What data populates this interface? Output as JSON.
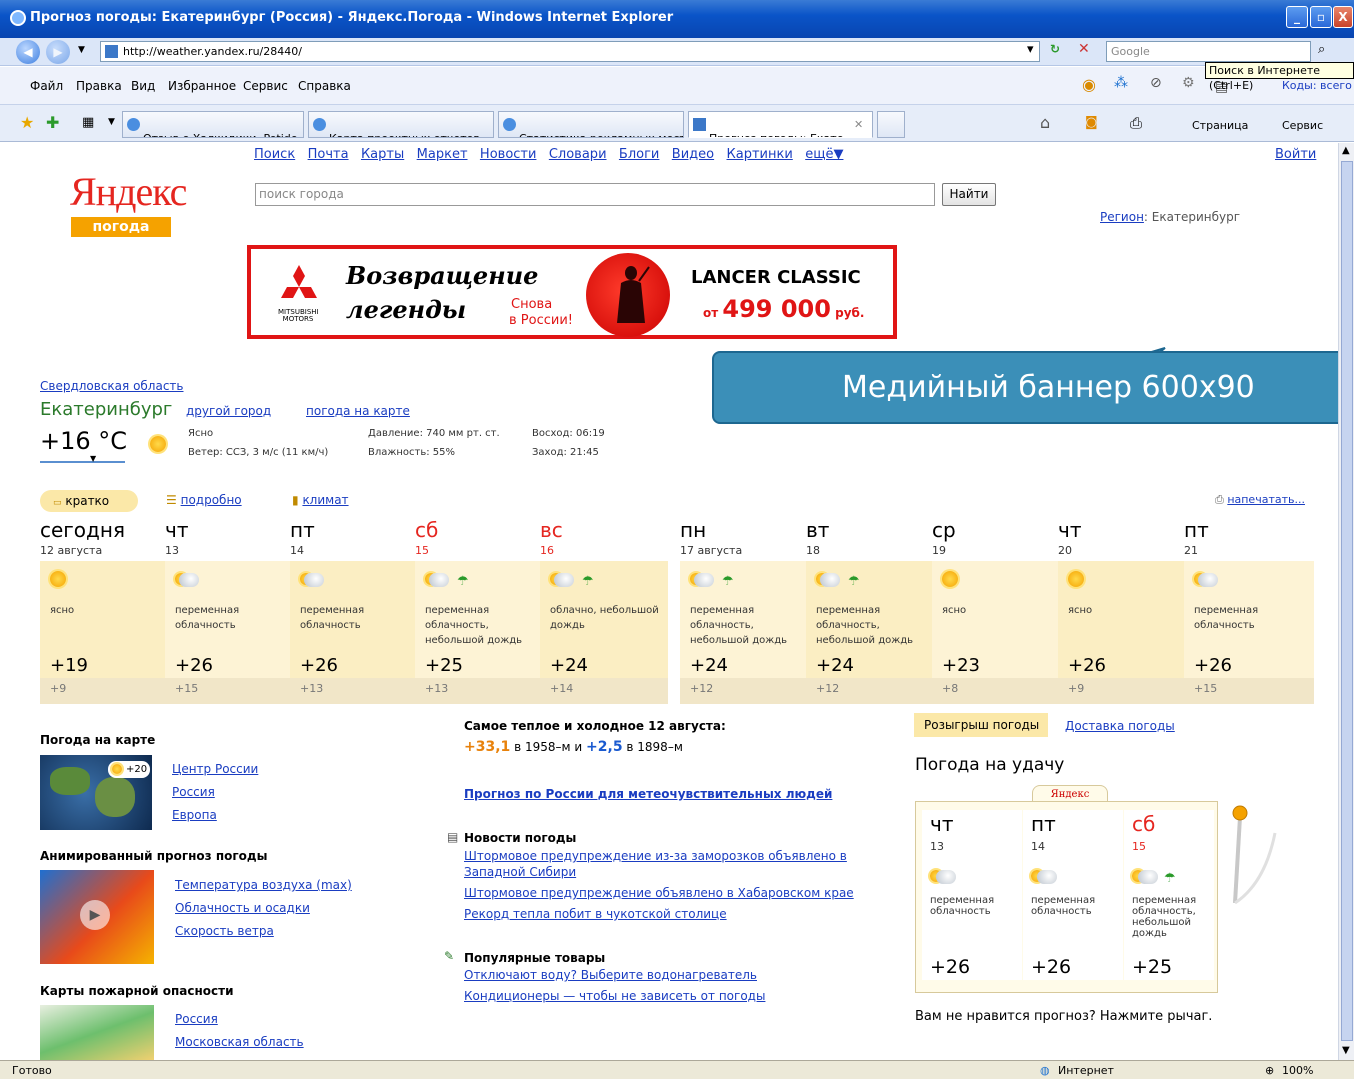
{
  "window": {
    "title": "Прогноз погоды: Екатеринбург (Россия) - Яндекс.Погода - Windows Internet Explorer",
    "buttons": [
      "_",
      "▫",
      "X"
    ]
  },
  "address_bar": {
    "url": "http://weather.yandex.ru/28440/",
    "search_placeholder": "Google"
  },
  "tooltip": "Поиск в Интернете (Ctrl+E)",
  "menu": [
    "Файл",
    "Правка",
    "Вид",
    "Избранное",
    "Сервис",
    "Справка"
  ],
  "codes_label": "Коды: всего н",
  "tabs": [
    {
      "label": "Отзыв о Халкидики, Potide..."
    },
    {
      "label": "Карта проектных отчетов ..."
    },
    {
      "label": "Статистика рекламных мест"
    },
    {
      "label": "Прогноз погоды: Екате..."
    }
  ],
  "right_tools": {
    "page": "Страница",
    "service": "Сервис"
  },
  "yandex": {
    "nav": [
      "Поиск",
      "Почта",
      "Карты",
      "Маркет",
      "Новости",
      "Словари",
      "Блоги",
      "Видео",
      "Картинки",
      "ещё▼"
    ],
    "login": "Войти",
    "logo": "Яндекс",
    "logo_sub": "погода",
    "search_placeholder": "поиск города",
    "find_button": "Найти",
    "region_label": "Регион",
    "region_value": ": Екатеринбург"
  },
  "banner": {
    "brand": "MITSUBISHI MOTORS",
    "line1": "Возвращение",
    "line2": "легенды",
    "again": "Снова",
    "in_russia": "в России!",
    "model": "LANCER CLASSIC",
    "price_prefix": "от",
    "price": "499 000",
    "currency": "руб."
  },
  "callout": "Медийный баннер 600х90",
  "current": {
    "region": "Свердловская область",
    "city": "Екатеринбург",
    "other_city": "другой город",
    "on_map": "погода на карте",
    "temp": "+16 °C",
    "cond": "Ясно",
    "wind": "Ветер: ССЗ, 3 м/с (11 км/ч)",
    "pressure": "Давление: 740 мм рт. ст.",
    "humidity": "Влажность: 55%",
    "sunrise": "Восход: 06:19",
    "sunset": "Заход: 21:45"
  },
  "modes": {
    "short": "кратко",
    "detail": "подробно",
    "climate": "климат",
    "print": "напечатать..."
  },
  "forecast": [
    {
      "day": "сегодня",
      "date": "12 августа",
      "icon": "sun",
      "cond": "ясно",
      "t_day": "+19",
      "t_night": "+9",
      "red": false
    },
    {
      "day": "чт",
      "date": "13",
      "icon": "cloud",
      "cond": "переменная облачность",
      "t_day": "+26",
      "t_night": "+15",
      "red": false
    },
    {
      "day": "пт",
      "date": "14",
      "icon": "cloud",
      "cond": "переменная облачность",
      "t_day": "+26",
      "t_night": "+13",
      "red": false
    },
    {
      "day": "сб",
      "date": "15",
      "icon": "cloud-rain",
      "cond": "переменная облачность, небольшой дождь",
      "t_day": "+25",
      "t_night": "+13",
      "red": true
    },
    {
      "day": "вс",
      "date": "16",
      "icon": "cloud-rain",
      "cond": "облачно, небольшой дождь",
      "t_day": "+24",
      "t_night": "+14",
      "red": true
    },
    {
      "day": "пн",
      "date": "17 августа",
      "icon": "cloud-rain",
      "cond": "переменная облачность, небольшой дождь",
      "t_day": "+24",
      "t_night": "+12",
      "red": false
    },
    {
      "day": "вт",
      "date": "18",
      "icon": "cloud-rain",
      "cond": "переменная облачность, небольшой дождь",
      "t_day": "+24",
      "t_night": "+12",
      "red": false
    },
    {
      "day": "ср",
      "date": "19",
      "icon": "sun",
      "cond": "ясно",
      "t_day": "+23",
      "t_night": "+8",
      "red": false
    },
    {
      "day": "чт",
      "date": "20",
      "icon": "sun",
      "cond": "ясно",
      "t_day": "+26",
      "t_night": "+9",
      "red": false
    },
    {
      "day": "пт",
      "date": "21",
      "icon": "cloud",
      "cond": "переменная облачность",
      "t_day": "+26",
      "t_night": "+15",
      "red": false
    }
  ],
  "left_col": {
    "map_title": "Погода на карте",
    "map_temp": "+20",
    "map_links": [
      "Центр России",
      "Россия",
      "Европа"
    ],
    "anim_title": "Анимированный прогноз погоды",
    "anim_links": [
      "Температура воздуха (max)",
      "Облачность и осадки",
      "Скорость ветра"
    ],
    "fire_title": "Карты пожарной опасности",
    "fire_links": [
      "Россия",
      "Московская область"
    ]
  },
  "middle_col": {
    "extreme_title": "Самое теплое и холодное 12 августа:",
    "warm": "+33,1",
    "warm_year": "в 1958–м и",
    "cold": "+2,5",
    "cold_year": "в 1898–м",
    "meteo_link": "Прогноз по России для метеочувствительных людей",
    "news_title": "Новости погоды",
    "news": [
      "Штормовое предупреждение из-за заморозков объявлено в Западной Сибири",
      "Штормовое предупреждение объявлено в Хабаровском крае",
      "Рекорд тепла побит в чукотской столице"
    ],
    "goods_title": "Популярные товары",
    "goods": [
      "Отключают воду? Выберите водонагреватель",
      "Кондиционеры — чтобы не зависеть от погоды"
    ]
  },
  "right_col": {
    "draw_tab": "Розыгрыш погоды",
    "delivery_tab": "Доставка погоды",
    "luck_title": "Погода на удачу",
    "slot_logo": "Яндекс",
    "slots": [
      {
        "day": "чт",
        "date": "13",
        "icon": "cloud",
        "cond": "переменная облачность",
        "temp": "+26",
        "red": false
      },
      {
        "day": "пт",
        "date": "14",
        "icon": "cloud",
        "cond": "переменная облачность",
        "temp": "+26",
        "red": false
      },
      {
        "day": "сб",
        "date": "15",
        "icon": "cloud-rain",
        "cond": "переменная облачность, небольшой дождь",
        "temp": "+25",
        "red": true
      }
    ],
    "lever_hint": "Вам не нравится прогноз? Нажмите рычаг."
  },
  "status": {
    "text": "Готово",
    "zone": "Интернет",
    "zoom": "100%"
  },
  "colors": {
    "accent_red": "#e52620",
    "link": "#1a3dc1",
    "forecast_bg": "#fbeec3",
    "callout": "#3b8fb8"
  }
}
